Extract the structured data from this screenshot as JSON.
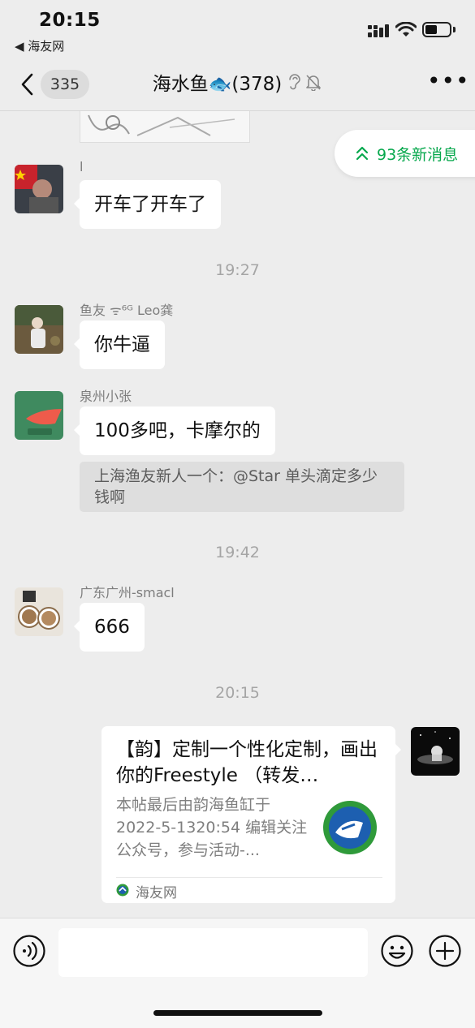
{
  "status": {
    "time": "20:15",
    "back_app": "◀ 海友网",
    "battery_percent": 50
  },
  "header": {
    "unread_count": "335",
    "title": "海水鱼🐟(378)",
    "more_label": "•••"
  },
  "new_messages": {
    "label": "93条新消息"
  },
  "messages": [
    {
      "sender": "l",
      "text": "开车了开车了"
    },
    {
      "timestamp": "19:27"
    },
    {
      "sender": "鱼友 ᯤ⁶ᴳ Leo龚",
      "text": "你牛逼"
    },
    {
      "sender": "泉州小张",
      "text": "100多吧，卡摩尔的",
      "quote": "上海渔友新人一个：@Star 单头滴定多少钱啊"
    },
    {
      "timestamp": "19:42"
    },
    {
      "sender": "广东广州-smacl",
      "text": "666"
    },
    {
      "timestamp": "20:15"
    }
  ],
  "link_card": {
    "title": "【韵】定制一个性化定制，画出你的Freestyle （转发…",
    "description": "本帖最后由韵海鱼缸于 2022-5-1320:54 编辑关注公众号，参与活动-...",
    "source": "海友网"
  },
  "colors": {
    "background": "#ededed",
    "bubble": "#ffffff",
    "accent_green": "#07a84d",
    "timestamp": "#a5a5a5",
    "quote_bg": "#dedede"
  },
  "icons": {
    "back": "chevron-left-icon",
    "ear": "ear-icon",
    "mute": "bell-off-icon",
    "more": "more-icon",
    "double_up": "double-chevron-up-icon",
    "voice": "voice-icon",
    "emoji": "emoji-icon",
    "plus": "plus-icon"
  }
}
